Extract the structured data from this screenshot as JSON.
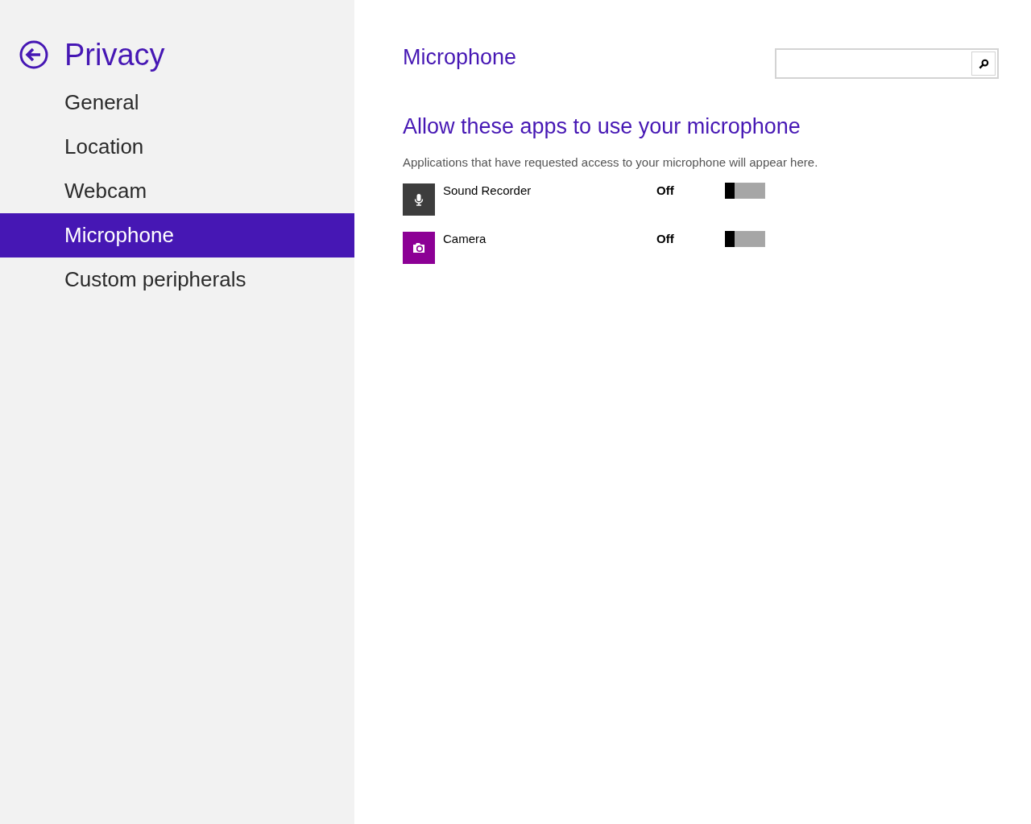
{
  "sidebar": {
    "title": "Privacy",
    "items": [
      {
        "label": "General",
        "selected": false
      },
      {
        "label": "Location",
        "selected": false
      },
      {
        "label": "Webcam",
        "selected": false
      },
      {
        "label": "Microphone",
        "selected": true
      },
      {
        "label": "Custom peripherals",
        "selected": false
      }
    ]
  },
  "main": {
    "title": "Microphone",
    "heading": "Allow these apps to use your microphone",
    "description": "Applications that have requested access to your microphone will appear here.",
    "apps": [
      {
        "name": "Sound Recorder",
        "kind": "microphone",
        "color": "#3d3d3d",
        "state": "Off",
        "on": false
      },
      {
        "name": "Camera",
        "kind": "camera",
        "color": "#8c0095",
        "state": "Off",
        "on": false
      }
    ]
  }
}
